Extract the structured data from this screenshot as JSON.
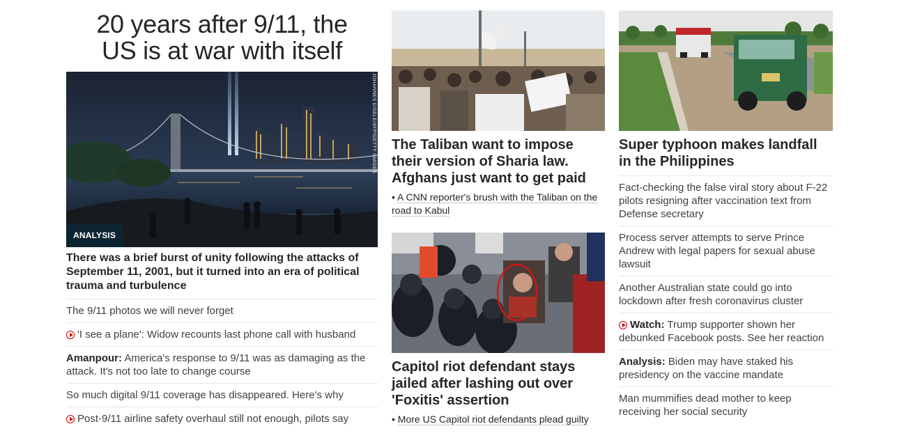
{
  "lead": {
    "title_line1": "20 years after 9/11, the",
    "title_line2": "US is at war with itself",
    "badge": "ANALYSIS",
    "credit": "JOHANNES EISELE/AFP/GETTY IMAGES",
    "summary": "There was a brief burst of unity following the attacks of September 11, 2001, but it turned into an era of political trauma and turbulence",
    "links": [
      {
        "label": "The 9/11 photos we will never forget",
        "video": false
      },
      {
        "label": "'I see a plane': Widow recounts last phone call with husband",
        "video": true
      },
      {
        "prefix": "Amanpour:",
        "label": " America's response to 9/11 was as damaging as the attack. It's not too late to change course",
        "video": false
      },
      {
        "label": "So much digital 9/11 coverage has disappeared. Here's why",
        "video": false
      },
      {
        "label": "Post-9/11 airline safety overhaul still not enough, pilots say",
        "video": true
      }
    ]
  },
  "middle": {
    "story1": {
      "headline": "The Taliban want to impose their version of Sharia law. Afghans just want to get paid",
      "sub": "A CNN reporter's brush with the Taliban on the road to Kabul"
    },
    "story2": {
      "headline": "Capitol riot defendant stays jailed after lashing out over 'Foxitis' assertion",
      "sub": "More US Capitol riot defendants plead guilty"
    }
  },
  "right": {
    "headline": "Super typhoon makes landfall in the Philippines",
    "links": [
      {
        "label": "Fact-checking the false viral story about F-22 pilots resigning after vaccination text from Defense secretary"
      },
      {
        "label": "Process server attempts to serve Prince Andrew with legal papers for sexual abuse lawsuit"
      },
      {
        "label": "Another Australian state could go into lockdown after fresh coronavirus cluster"
      },
      {
        "prefix": "Watch:",
        "label": " Trump supporter shown her debunked Facebook posts. See her reaction",
        "video": true
      },
      {
        "prefix": "Analysis:",
        "label": " Biden may have staked his presidency on the vaccine mandate"
      },
      {
        "label": "Man mummifies dead mother to keep receiving her social security"
      }
    ]
  },
  "icons": {
    "video": "play-circle-icon"
  },
  "colors": {
    "accent": "#cc0000",
    "badge_bg": "#0c2431",
    "text": "#262626"
  }
}
